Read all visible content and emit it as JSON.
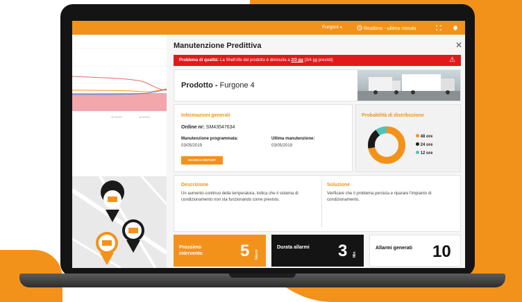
{
  "topbar": {
    "filter_label": "Furgoni",
    "realtime_label": "Realtime - ultimo minuto"
  },
  "left_chart": {
    "tick_labels": [
      "10:19:20",
      "10:19:20"
    ]
  },
  "modal": {
    "title": "Manutenzione Predittiva",
    "alert": {
      "prefix": "Problema di qualità:",
      "text": "La Shelf-life del prodotto è diminuita a",
      "value": "2/3 gg",
      "suffix": "(3/4 gg previsti)"
    },
    "product": {
      "label": "Prodotto",
      "separator": "-",
      "name": "Furgone 4"
    },
    "general_info": {
      "heading": "Informazioni generali",
      "order_label": "Ordine nr:",
      "order_value": "SM43547634",
      "scheduled_label": "Manutenzione programmata:",
      "scheduled_value": "03/05/2019",
      "last_label": "Ultima manutenzione:",
      "last_value": "03/05/2019",
      "report_button": "SCARICA REPORT"
    },
    "distribution": {
      "heading": "Probabilità di distribuzione",
      "legend": [
        {
          "label": "48 ore",
          "color": "#f3921a",
          "fraction": 0.72
        },
        {
          "label": "24 ore",
          "color": "#1a1a1a",
          "fraction": 0.18
        },
        {
          "label": "12 ore",
          "color": "#4fc3b8",
          "fraction": 0.1
        }
      ]
    },
    "description": {
      "heading": "Descrizione",
      "text": "Un aumento continuo della temperatura, indica che il sistema di condizionamento non sta funzionando come previsto."
    },
    "solution": {
      "heading": "Soluzione",
      "text": "Verificare che il problema persista e riparare l'impianto di condizionamento."
    },
    "tiles": [
      {
        "label": "Prossimo intervento",
        "value": "5",
        "unit": "Giorni"
      },
      {
        "label": "Durata allarmi",
        "value": "3",
        "unit": "Min"
      },
      {
        "label": "Allarmi generati",
        "value": "10",
        "unit": ""
      }
    ]
  },
  "colors": {
    "accent": "#f3921a",
    "alert": "#e2191a",
    "dark": "#1a1a1a",
    "teal": "#4fc3b8"
  },
  "icons": [
    "chevron-down-icon",
    "clock-icon",
    "fullscreen-icon",
    "bell-icon",
    "close-icon",
    "warning-icon",
    "map-pin-icon",
    "truck-icon"
  ]
}
